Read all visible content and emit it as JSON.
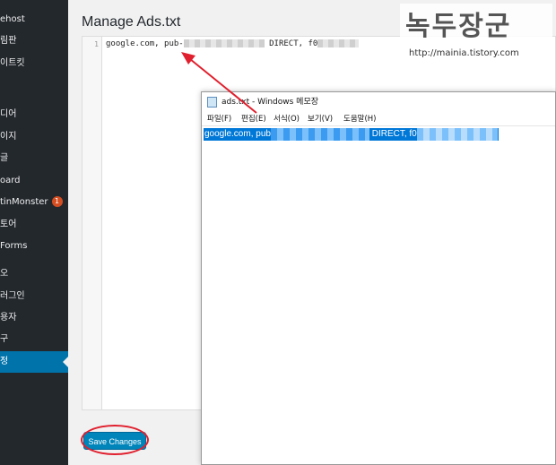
{
  "sidebar": {
    "items": [
      {
        "label": "ehost"
      },
      {
        "label": "림판"
      },
      {
        "label": "이트킷"
      },
      {
        "label": "디어"
      },
      {
        "label": "이지"
      },
      {
        "label": "글"
      },
      {
        "label": "oard"
      },
      {
        "label": "tinMonster",
        "badge": "1"
      },
      {
        "label": "토어"
      },
      {
        "label": "Forms"
      },
      {
        "label": "오"
      },
      {
        "label": "러그인"
      },
      {
        "label": "용자"
      },
      {
        "label": "구"
      },
      {
        "label": "정"
      }
    ]
  },
  "page": {
    "title": "Manage Ads.txt",
    "line_number": "1",
    "code_prefix": "google.com, pub-",
    "code_mid": " DIRECT, f0",
    "save_label": "Save Changes"
  },
  "notepad": {
    "title": "ads.txt - Windows 메모장",
    "menu": [
      "파일(F)",
      "편집(E)",
      "서식(O)",
      "보기(V)",
      "도움말(H)"
    ],
    "text_prefix": "google.com, pub",
    "text_mid": " DIRECT, f0"
  },
  "watermark": {
    "title": "녹두장군",
    "url": "http://mainia.tistory.com"
  },
  "colors": {
    "sidebar_bg": "#23282d",
    "active_menu": "#0073aa",
    "primary_button": "#0085ba",
    "selection": "#0078d7",
    "annotation_red": "#e0202e"
  }
}
